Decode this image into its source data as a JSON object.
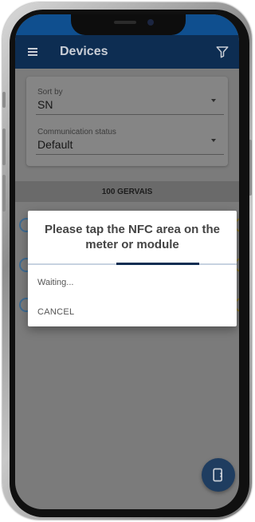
{
  "app_bar": {
    "title": "Devices",
    "menu_icon": "hamburger-menu-icon",
    "filter_icon": "filter-funnel-icon",
    "background": "#0d2d52"
  },
  "sort_panel": {
    "sort_by": {
      "label": "Sort by",
      "value": "SN"
    },
    "communication_status": {
      "label": "Communication status",
      "value": "Default"
    }
  },
  "device_list": {
    "group_header": "100 GERVAIS"
  },
  "dialog": {
    "title": "Please tap the NFC area on the meter or module",
    "status": "Waiting...",
    "cancel_label": "CANCEL"
  },
  "fab": {
    "icon": "nfc-phone-icon",
    "color": "#1f3d60"
  }
}
